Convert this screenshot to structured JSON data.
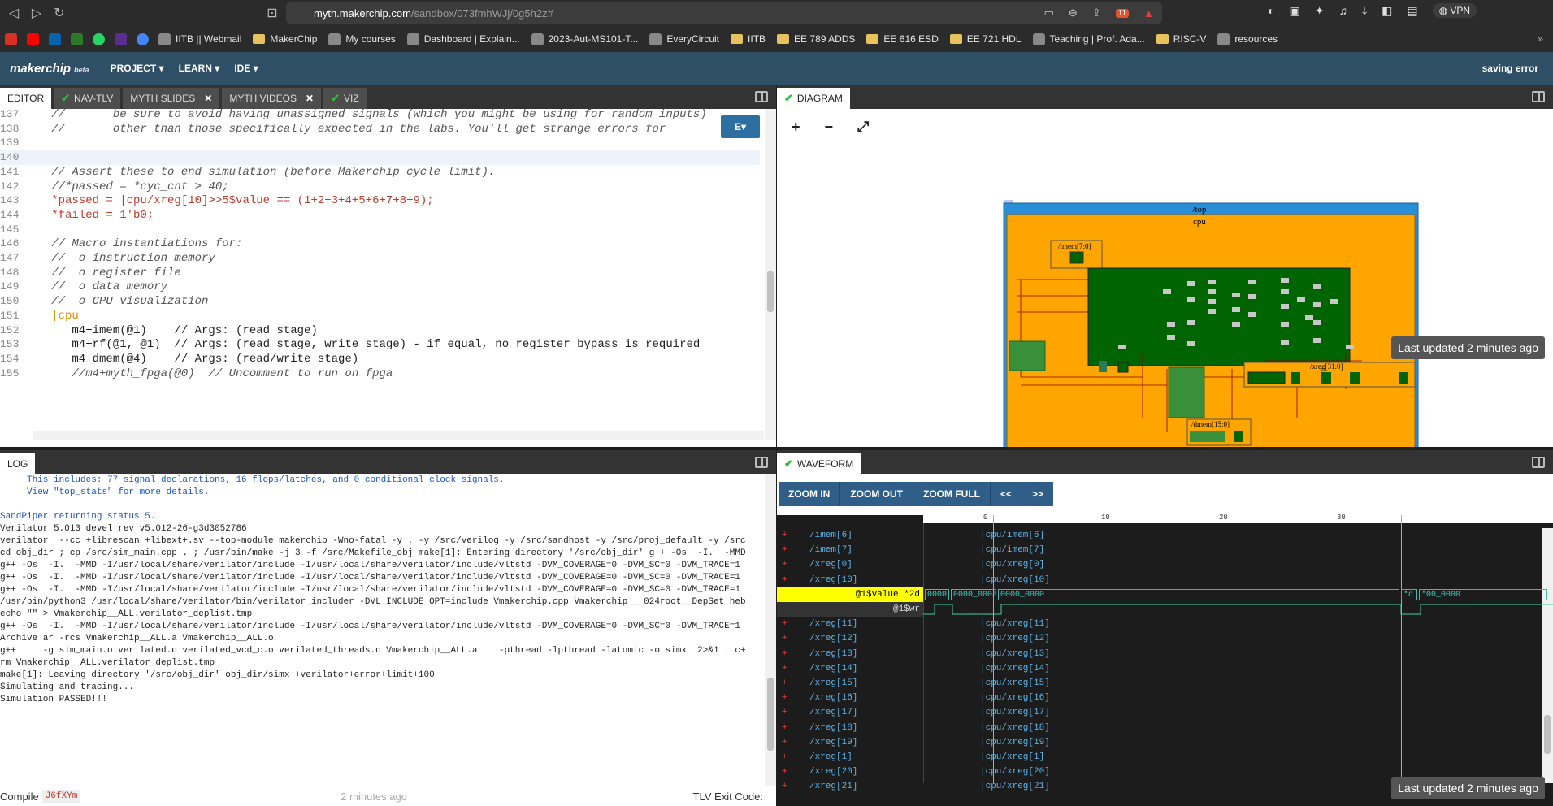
{
  "browser": {
    "url_host": "myth.makerchip.com",
    "url_path": "/sandbox/073fmhWJj/0g5h2z#",
    "vpn_label": "VPN",
    "brave_badge": "11"
  },
  "bookmarks": [
    {
      "label": "IITB || Webmail",
      "icon": "globe-icon"
    },
    {
      "label": "MakerChip",
      "icon": "folder-icon"
    },
    {
      "label": "My courses",
      "icon": "moodle-icon"
    },
    {
      "label": "Dashboard | Explain...",
      "icon": "globe-icon"
    },
    {
      "label": "2023-Aut-MS101-T...",
      "icon": "page-icon"
    },
    {
      "label": "EveryCircuit",
      "icon": "sparkle-icon"
    },
    {
      "label": "IITB",
      "icon": "folder-icon"
    },
    {
      "label": "EE 789 ADDS",
      "icon": "folder-icon"
    },
    {
      "label": "EE 616 ESD",
      "icon": "folder-icon"
    },
    {
      "label": "EE 721 HDL",
      "icon": "folder-icon"
    },
    {
      "label": "Teaching | Prof. Ada...",
      "icon": "page-icon"
    },
    {
      "label": "RISC-V",
      "icon": "folder-icon"
    },
    {
      "label": "resources",
      "icon": "page-icon"
    }
  ],
  "appbar": {
    "logo": "makerchip",
    "beta": "beta",
    "menus": [
      "PROJECT ▾",
      "LEARN ▾",
      "IDE ▾"
    ],
    "status": "saving error"
  },
  "editor": {
    "tabs": [
      {
        "label": "EDITOR",
        "check": false,
        "close": false
      },
      {
        "label": "NAV-TLV",
        "check": true,
        "close": false
      },
      {
        "label": "MYTH SLIDES",
        "check": false,
        "close": true
      },
      {
        "label": "MYTH VIDEOS",
        "check": false,
        "close": true
      },
      {
        "label": "VIZ",
        "check": true,
        "close": false
      }
    ],
    "e_button": "E▾",
    "lines": [
      {
        "n": "137",
        "text": "   //       be sure to avoid having unassigned signals (which you might be using for random inputs)"
      },
      {
        "n": "138",
        "text": "   //       other than those specifically expected in the labs. You'll get strange errors for"
      },
      {
        "n": "139",
        "text": ""
      },
      {
        "n": "140",
        "text": ""
      },
      {
        "n": "141",
        "text": "   // Assert these to end simulation (before Makerchip cycle limit)."
      },
      {
        "n": "142",
        "text": "   //*passed = *cyc_cnt > 40;"
      },
      {
        "n": "143",
        "text": "   *passed = |cpu/xreg[10]>>5$value == (1+2+3+4+5+6+7+8+9);"
      },
      {
        "n": "144",
        "text": "   *failed = 1'b0;"
      },
      {
        "n": "145",
        "text": ""
      },
      {
        "n": "146",
        "text": "   // Macro instantiations for:"
      },
      {
        "n": "147",
        "text": "   //  o instruction memory"
      },
      {
        "n": "148",
        "text": "   //  o register file"
      },
      {
        "n": "149",
        "text": "   //  o data memory"
      },
      {
        "n": "150",
        "text": "   //  o CPU visualization"
      },
      {
        "n": "151",
        "text": "   |cpu"
      },
      {
        "n": "152",
        "text": "      m4+imem(@1)    // Args: (read stage)"
      },
      {
        "n": "153",
        "text": "      m4+rf(@1, @1)  // Args: (read stage, write stage) - if equal, no register bypass is required"
      },
      {
        "n": "154",
        "text": "      m4+dmem(@4)    // Args: (read/write stage)"
      },
      {
        "n": "155",
        "text": "      //m4+myth_fpga(@0)  // Uncomment to run on fpga"
      }
    ]
  },
  "log": {
    "tab": "LOG",
    "lines": [
      {
        "text": "     This includes: 77 signal declarations, 16 flops/latches, and 0 conditional clock signals.",
        "blue": true
      },
      {
        "text": "     View \"top_stats\" for more details.",
        "blue": true
      },
      {
        "text": "",
        "blue": false
      },
      {
        "text": "SandPiper returning status 5.",
        "blue": true
      },
      {
        "text": "Verilator 5.013 devel rev v5.012-26-g3d3052786",
        "blue": false
      },
      {
        "text": "verilator  --cc +librescan +libext+.sv --top-module makerchip -Wno-fatal -y . -y /src/verilog -y /src/sandhost -y /src/proj_default -y /src",
        "blue": false
      },
      {
        "text": "cd obj_dir ; cp /src/sim_main.cpp . ; /usr/bin/make -j 3 -f /src/Makefile_obj make[1]: Entering directory '/src/obj_dir' g++ -Os  -I.  -MMD",
        "blue": false
      },
      {
        "text": "g++ -Os  -I.  -MMD -I/usr/local/share/verilator/include -I/usr/local/share/verilator/include/vltstd -DVM_COVERAGE=0 -DVM_SC=0 -DVM_TRACE=1",
        "blue": false
      },
      {
        "text": "g++ -Os  -I.  -MMD -I/usr/local/share/verilator/include -I/usr/local/share/verilator/include/vltstd -DVM_COVERAGE=0 -DVM_SC=0 -DVM_TRACE=1",
        "blue": false
      },
      {
        "text": "g++ -Os  -I.  -MMD -I/usr/local/share/verilator/include -I/usr/local/share/verilator/include/vltstd -DVM_COVERAGE=0 -DVM_SC=0 -DVM_TRACE=1",
        "blue": false
      },
      {
        "text": "/usr/bin/python3 /usr/local/share/verilator/bin/verilator_includer -DVL_INCLUDE_OPT=include Vmakerchip.cpp Vmakerchip___024root__DepSet_heb",
        "blue": false
      },
      {
        "text": "echo \"\" > Vmakerchip__ALL.verilator_deplist.tmp",
        "blue": false
      },
      {
        "text": "g++ -Os  -I.  -MMD -I/usr/local/share/verilator/include -I/usr/local/share/verilator/include/vltstd -DVM_COVERAGE=0 -DVM_SC=0 -DVM_TRACE=1",
        "blue": false
      },
      {
        "text": "Archive ar -rcs Vmakerchip__ALL.a Vmakerchip__ALL.o",
        "blue": false
      },
      {
        "text": "g++     -g sim_main.o verilated.o verilated_vcd_c.o verilated_threads.o Vmakerchip__ALL.a    -pthread -lpthread -latomic -o simx  2>&1 | c+",
        "blue": false
      },
      {
        "text": "rm Vmakerchip__ALL.verilator_deplist.tmp",
        "blue": false
      },
      {
        "text": "make[1]: Leaving directory '/src/obj_dir' obj_dir/simx +verilator+error+limit+100",
        "blue": false
      },
      {
        "text": "Simulating and tracing...",
        "blue": false
      },
      {
        "text": "Simulation PASSED!!!",
        "blue": false
      }
    ],
    "compile_label": "Compile",
    "compile_id": "J6fXYm",
    "compile_time": "2 minutes ago",
    "exit_label": "TLV Exit Code:"
  },
  "diagram": {
    "tab": "DIAGRAM",
    "tools": [
      "+",
      "−",
      "⤢"
    ],
    "top_label": "/top",
    "cpu_label": "cpu",
    "imem_label": "/imem[7:0]",
    "xreg_label": "/xreg[31:0]",
    "dmem_label": "/dmem[15:0]",
    "last_updated": "Last updated 2 minutes ago"
  },
  "waveform": {
    "tab": "WAVEFORM",
    "buttons": [
      "ZOOM IN",
      "ZOOM OUT",
      "ZOOM FULL",
      "<<",
      ">>"
    ],
    "ruler_ticks": [
      "0",
      "10",
      "20",
      "30"
    ],
    "rows_before": [
      {
        "name": "/imem[6]",
        "value": "|cpu/imem[6]"
      },
      {
        "name": "/imem[7]",
        "value": "|cpu/imem[7]"
      },
      {
        "name": "/xreg[0]",
        "value": "|cpu/xreg[0]"
      },
      {
        "name": "/xreg[10]",
        "value": "|cpu/xreg[10]"
      }
    ],
    "value_signal": "@1$value *2d",
    "value_segments": [
      "0000",
      "0000_000a",
      "0000_0000",
      "*d",
      "*00_0000"
    ],
    "wr_signal": "@1$wr",
    "rows_after": [
      {
        "name": "/xreg[11]",
        "value": "|cpu/xreg[11]"
      },
      {
        "name": "/xreg[12]",
        "value": "|cpu/xreg[12]"
      },
      {
        "name": "/xreg[13]",
        "value": "|cpu/xreg[13]"
      },
      {
        "name": "/xreg[14]",
        "value": "|cpu/xreg[14]"
      },
      {
        "name": "/xreg[15]",
        "value": "|cpu/xreg[15]"
      },
      {
        "name": "/xreg[16]",
        "value": "|cpu/xreg[16]"
      },
      {
        "name": "/xreg[17]",
        "value": "|cpu/xreg[17]"
      },
      {
        "name": "/xreg[18]",
        "value": "|cpu/xreg[18]"
      },
      {
        "name": "/xreg[19]",
        "value": "|cpu/xreg[19]"
      },
      {
        "name": "/xreg[1]",
        "value": "|cpu/xreg[1]"
      },
      {
        "name": "/xreg[20]",
        "value": "|cpu/xreg[20]"
      },
      {
        "name": "/xreg[21]",
        "value": "|cpu/xreg[21]"
      }
    ],
    "last_updated": "Last updated 2 minutes ago"
  }
}
